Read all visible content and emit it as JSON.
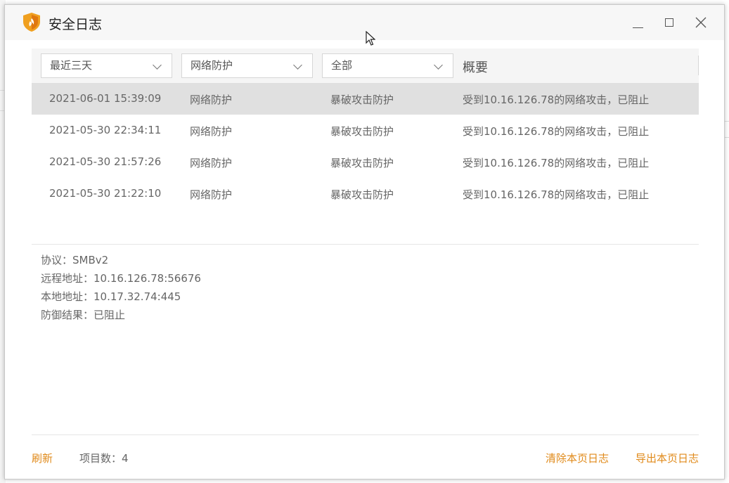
{
  "window": {
    "title": "安全日志",
    "icon": "flame-shield-icon",
    "accent_color": "#e08a1a"
  },
  "filters": {
    "time_range": "最近三天",
    "category": "网络防护",
    "event_type": "全部",
    "summary_header": "概要"
  },
  "rows": [
    {
      "time": "2021-06-01 15:39:09",
      "category": "网络防护",
      "event": "暴破攻击防护",
      "summary": "受到10.16.126.78的网络攻击，已阻止",
      "selected": true
    },
    {
      "time": "2021-05-30 22:34:11",
      "category": "网络防护",
      "event": "暴破攻击防护",
      "summary": "受到10.16.126.78的网络攻击，已阻止",
      "selected": false
    },
    {
      "time": "2021-05-30 21:57:26",
      "category": "网络防护",
      "event": "暴破攻击防护",
      "summary": "受到10.16.126.78的网络攻击，已阻止",
      "selected": false
    },
    {
      "time": "2021-05-30 21:22:10",
      "category": "网络防护",
      "event": "暴破攻击防护",
      "summary": "受到10.16.126.78的网络攻击，已阻止",
      "selected": false
    }
  ],
  "detail": {
    "protocol": "协议：SMBv2",
    "remote": "远程地址：10.16.126.78:56676",
    "local": "本地地址：10.17.32.74:445",
    "result": "防御结果：已阻止"
  },
  "footer": {
    "refresh": "刷新",
    "count": "项目数：4",
    "clear": "清除本页日志",
    "export": "导出本页日志"
  }
}
